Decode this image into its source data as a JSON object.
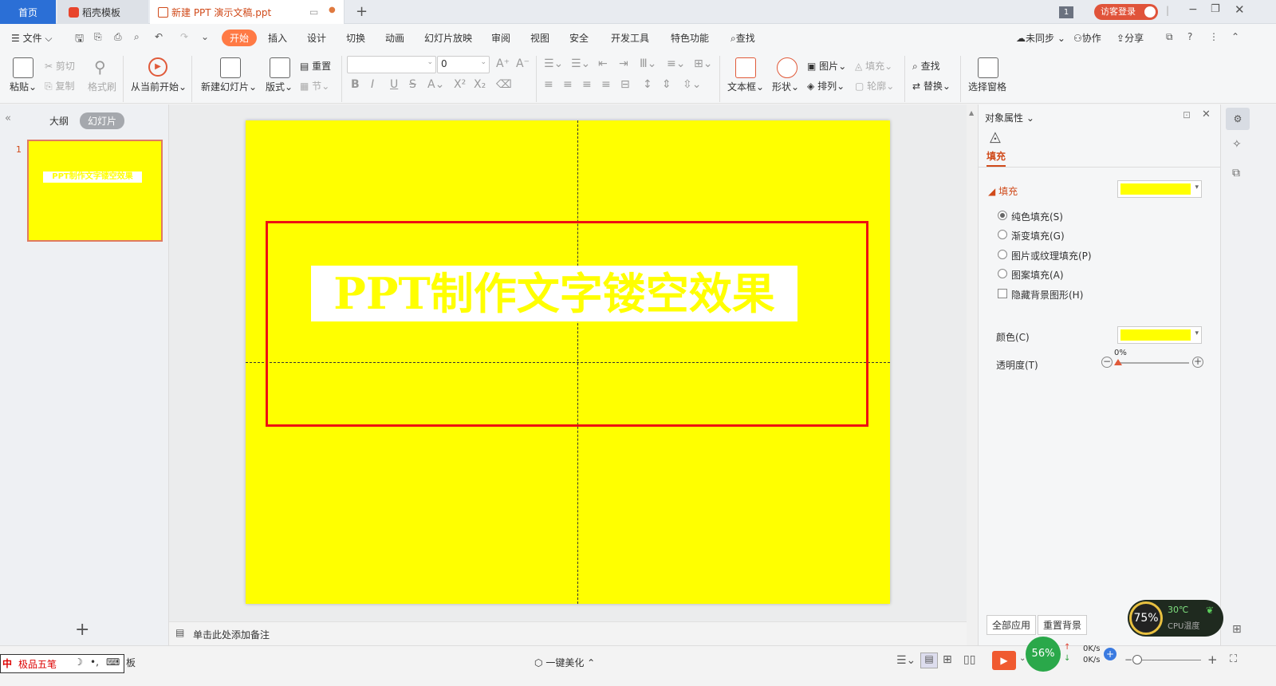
{
  "tabs": {
    "home": "首页",
    "docer": "稻壳模板",
    "doc": "新建 PPT 演示文稿.ppt",
    "new": "+"
  },
  "title_right": {
    "badge": "1",
    "login": "访客登录"
  },
  "menu": {
    "file": "文件",
    "items": [
      "开始",
      "插入",
      "设计",
      "切换",
      "动画",
      "幻灯片放映",
      "审阅",
      "视图",
      "安全",
      "开发工具",
      "特色功能"
    ],
    "search": "查找",
    "sync": "未同步",
    "collab": "协作",
    "share": "分享"
  },
  "ribbon": {
    "paste": "粘贴",
    "cut": "剪切",
    "copy": "复制",
    "format_painter": "格式刷",
    "from_current": "从当前开始",
    "new_slide": "新建幻灯片",
    "layout": "版式",
    "reset": "重置",
    "section": "节",
    "font_size": "0",
    "textbox": "文本框",
    "shape": "形状",
    "picture": "图片",
    "fill": "填充",
    "arrange": "排列",
    "outline": "轮廓",
    "find": "查找",
    "replace": "替换",
    "select_pane": "选择窗格"
  },
  "left_panel": {
    "outline": "大纲",
    "slides": "幻灯片",
    "slide_number": "1",
    "add": "+"
  },
  "slide": {
    "title": "PPT制作文字镂空效果",
    "bg_color": "#ffff00",
    "text_color": "#ffff00",
    "frame_color": "#ee1111"
  },
  "notes": {
    "placeholder": "单击此处添加备注"
  },
  "right_panel": {
    "header": "对象属性",
    "tab": "填充",
    "section": "填充",
    "options": [
      "纯色填充(S)",
      "渐变填充(G)",
      "图片或纹理填充(P)",
      "图案填充(A)"
    ],
    "hide_bg": "隐藏背景图形(H)",
    "color_label": "颜色(C)",
    "transparency_label": "透明度(T)",
    "transparency_value": "0%",
    "fill_color": "#ffff00"
  },
  "status": {
    "beautify": "一键美化",
    "ime": "极品五笔",
    "ime_extra": "板",
    "cpu_temp": "30℃",
    "cpu_label": "CPU温度",
    "cpu_usage": "75%",
    "mem": "56%",
    "net_up": "0K/s",
    "net_down": "0K/s",
    "apply_all": "全部应用",
    "reset_bg": "重置背景"
  }
}
